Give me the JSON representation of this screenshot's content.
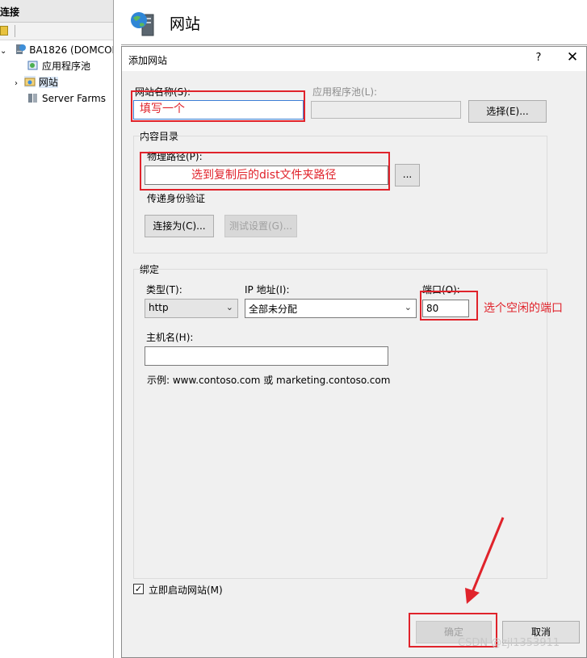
{
  "connections": {
    "header": "连接",
    "tree": [
      {
        "label": "BA1826 (DOMCOR",
        "icon": "server-icon"
      },
      {
        "label": "应用程序池",
        "icon": "app-pool-icon"
      },
      {
        "label": "网站",
        "icon": "sites-folder-icon"
      },
      {
        "label": "Server Farms",
        "icon": "server-farms-icon"
      }
    ]
  },
  "main": {
    "title": "网站",
    "icon": "globe-server-icon"
  },
  "dialog": {
    "title": "添加网站",
    "help": "?",
    "close": "✕",
    "site_name": {
      "label": "网站名称(S):",
      "value": ""
    },
    "app_pool": {
      "label": "应用程序池(L):",
      "value": "",
      "select_button": "选择(E)..."
    },
    "content_dir": {
      "group_label": "内容目录",
      "physical_path": {
        "label": "物理路径(P):",
        "value": "",
        "browse_button": "..."
      },
      "pass_through_auth": "传递身份验证",
      "connect_as_button": "连接为(C)...",
      "test_settings_button": "测试设置(G)..."
    },
    "binding": {
      "group_label": "绑定",
      "type": {
        "label": "类型(T):",
        "value": "http"
      },
      "ip": {
        "label": "IP 地址(I):",
        "value": "全部未分配"
      },
      "port": {
        "label": "端口(O):",
        "value": "80"
      },
      "host": {
        "label": "主机名(H):",
        "value": ""
      },
      "example": "示例: www.contoso.com 或 marketing.contoso.com"
    },
    "start_now": {
      "label": "立即启动网站(M)",
      "checked": true
    },
    "ok_button": "确定",
    "cancel_button": "取消"
  },
  "annotations": {
    "site_name_note": "填写一个",
    "path_note": "选到复制后的dist文件夹路径",
    "port_note": "选个空闲的端口",
    "color": "#e0232b"
  },
  "watermark": "CSDN @zjl1353911"
}
